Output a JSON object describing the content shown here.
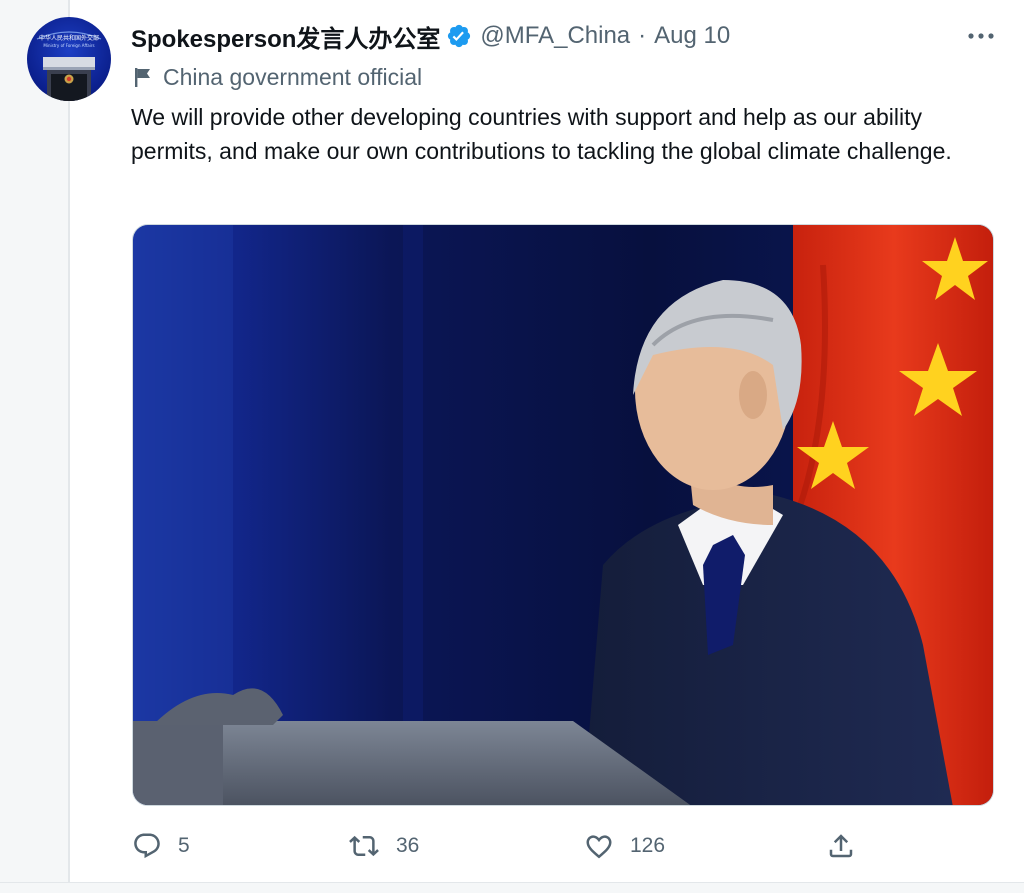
{
  "tweet": {
    "display_name": "Spokesperson发言人办公室",
    "handle": "@MFA_China",
    "separator": "·",
    "date": "Aug 10",
    "label": "China government official",
    "text": "We will provide other developing countries with support and help as our ability permits, and make our own contributions to tackling the global climate challenge.",
    "avatar_text": "中华人民共和国外交部",
    "avatar_subtext": "Ministry of Foreign Affairs"
  },
  "actions": {
    "reply_count": "5",
    "retweet_count": "36",
    "like_count": "126"
  },
  "icons": {
    "verified": "verified-badge-icon",
    "label": "flag-icon",
    "more": "more-icon",
    "reply": "reply-icon",
    "retweet": "retweet-icon",
    "like": "like-icon",
    "share": "share-icon"
  },
  "colors": {
    "text_primary": "#0f1419",
    "text_secondary": "#536471",
    "verified_blue": "#1d9bf0",
    "flag_red": "#de2910",
    "flag_star": "#ffde00"
  }
}
